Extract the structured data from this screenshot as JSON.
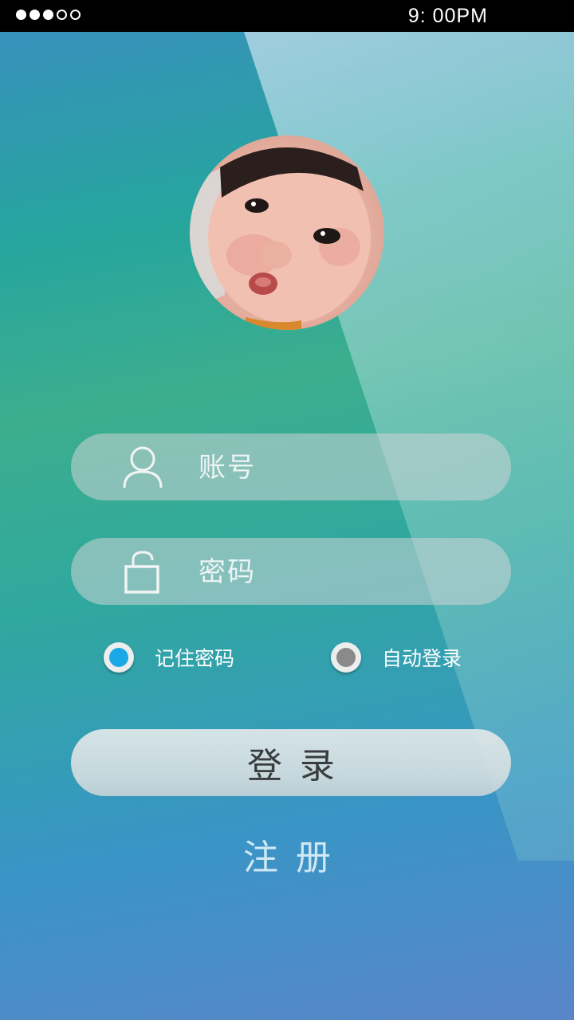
{
  "status_bar": {
    "time": "9: 00PM",
    "signal_dots": [
      true,
      true,
      true,
      false,
      false
    ]
  },
  "avatar": {
    "icon": "user-avatar-photo"
  },
  "form": {
    "account": {
      "placeholder": "账号",
      "value": "",
      "icon": "person-icon"
    },
    "password": {
      "placeholder": "密码",
      "value": "",
      "icon": "lock-icon"
    }
  },
  "options": {
    "remember_password": {
      "label": "记住密码",
      "checked": true
    },
    "auto_login": {
      "label": "自动登录",
      "checked": false
    }
  },
  "buttons": {
    "login_label": "登录",
    "register_label": "注册"
  },
  "colors": {
    "accent_radio": "#1aa8e6",
    "unchecked_radio": "#8a8a8a",
    "button_text": "#3a3d3f"
  }
}
